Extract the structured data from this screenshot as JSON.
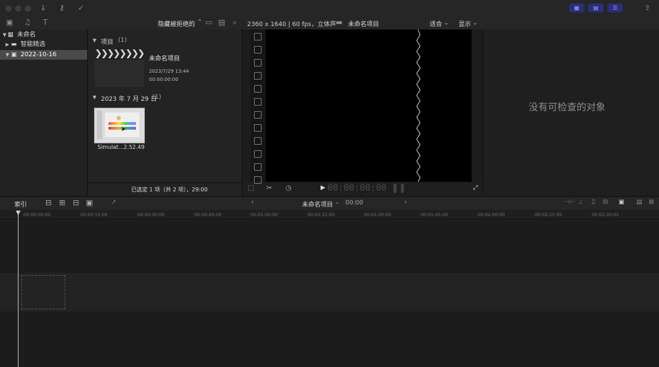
{
  "toolbar": {
    "layout_buttons": [
      "browser-layout",
      "timeline-layout",
      "inspector-layout"
    ]
  },
  "sidebar": {
    "items": [
      {
        "label": "未命名",
        "icon": "library-icon"
      },
      {
        "label": "智能精选",
        "icon": "folder-icon"
      },
      {
        "label": "2022-10-16",
        "icon": "event-icon"
      }
    ]
  },
  "browser": {
    "filter_label": "隐藏被拒绝的",
    "section1": {
      "title": "项目",
      "count": "(1)"
    },
    "project": {
      "name": "未命名项目",
      "date": "2023/7/29 13:44",
      "duration": "00:00:00:00"
    },
    "section2": {
      "title": "2023 年 7 月 29 日",
      "count": "(1)"
    },
    "clip": {
      "name": "Simulat...2.52.49"
    },
    "status": "已选定 1 项（共 2 项），29:00"
  },
  "viewer": {
    "format": "2360 x 1640 | 60 fps，立体声",
    "project_title": "未命名项目",
    "fit_label": "适合",
    "display_label": "显示",
    "timecode": "00:00:00:00"
  },
  "inspector": {
    "empty_text": "没有可检查的对象"
  },
  "timeline": {
    "index_label": "索引",
    "project_name": "未命名项目",
    "duration": "00:00",
    "ticks": [
      "00:00:00:00",
      "00:00:15:00",
      "00:00:30:00",
      "00:00:45:00",
      "00:01:00:00",
      "00:01:15:00",
      "00:01:30:00",
      "00:01:45:00",
      "00:02:00:00",
      "00:02:15:00",
      "00:02:30:00"
    ]
  }
}
